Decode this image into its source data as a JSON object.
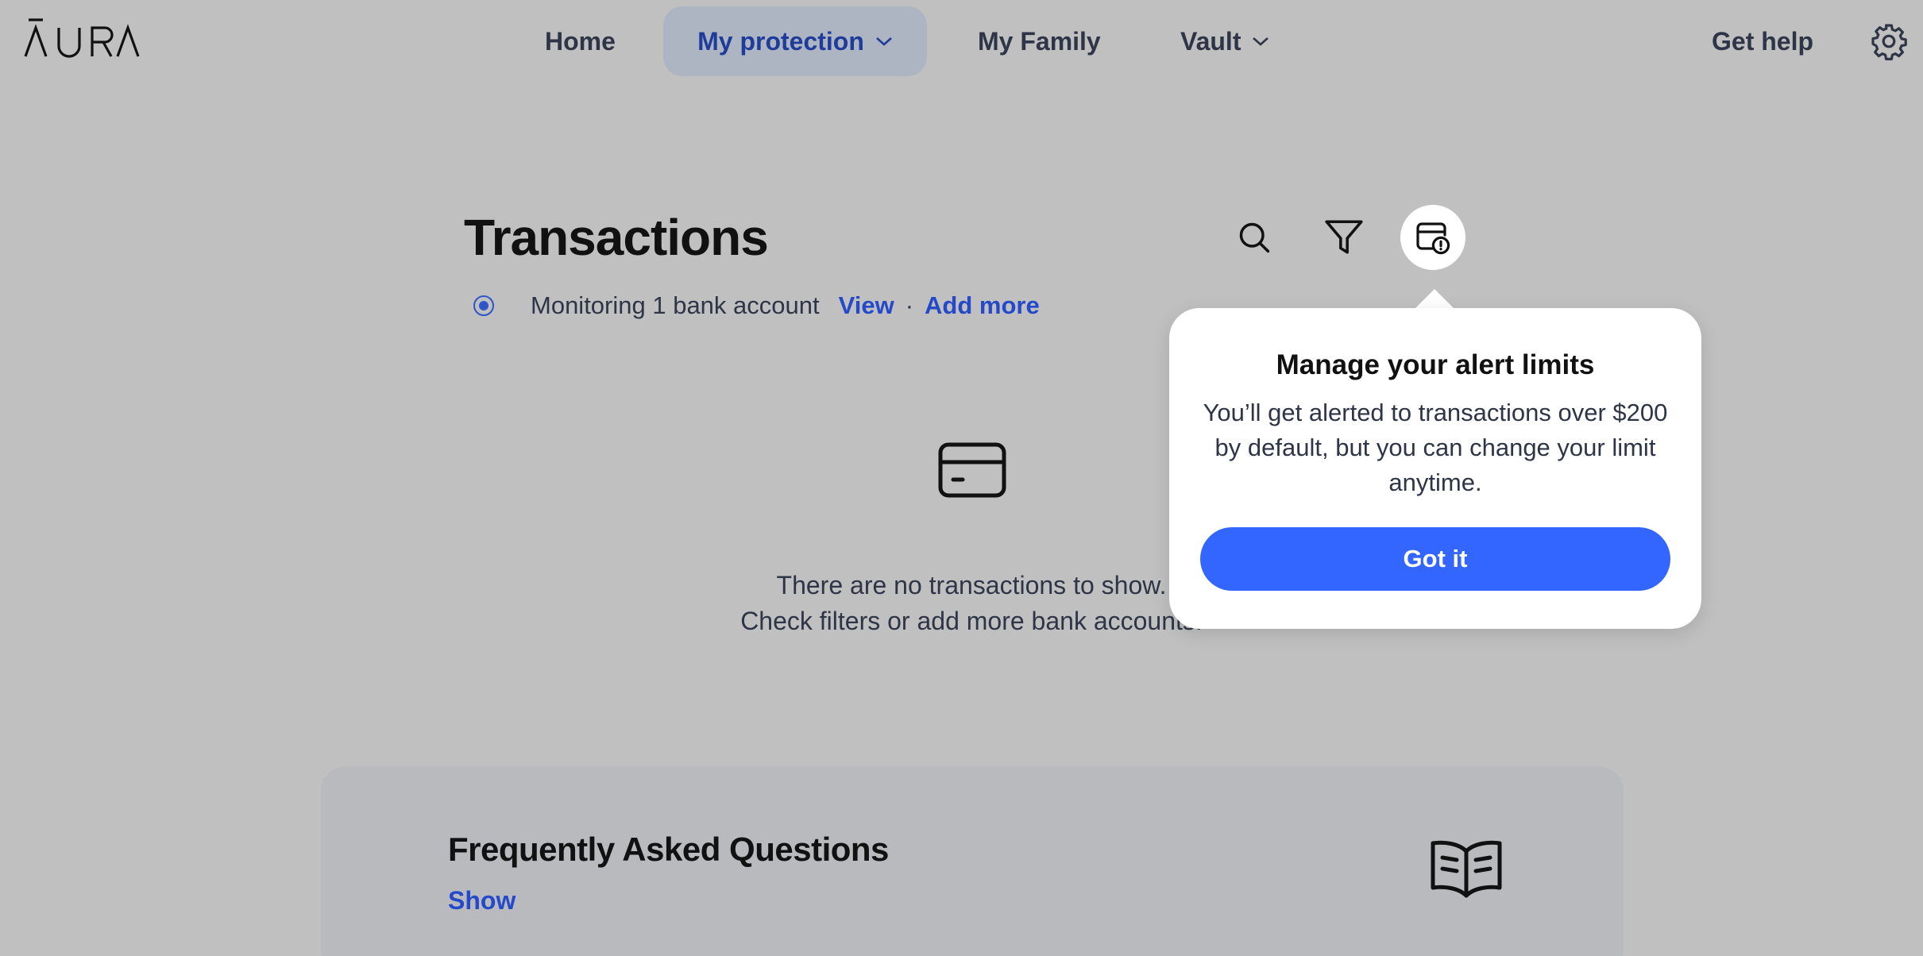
{
  "app": {
    "logo_text": "AURA"
  },
  "nav": {
    "home": "Home",
    "my_protection": "My protection",
    "my_family": "My Family",
    "vault": "Vault",
    "get_help": "Get help"
  },
  "page": {
    "title": "Transactions",
    "monitoring_text": "Monitoring 1 bank account",
    "view_link": "View",
    "separator": "·",
    "add_more_link": "Add more"
  },
  "empty_state": {
    "line1": "There are no transactions to show.",
    "line2": "Check filters or add more bank accounts."
  },
  "faq": {
    "title": "Frequently Asked Questions",
    "show_link": "Show"
  },
  "popover": {
    "title": "Manage your alert limits",
    "body": "You’ll get alerted to transactions over $200 by default, but you can change your limit anytime.",
    "button": "Got it"
  },
  "colors": {
    "accent": "#3366ff",
    "link": "#2449c9",
    "overlay_bg": "#c0c0c0"
  },
  "icons": [
    "aura-logo",
    "chevron-down-icon",
    "gear-icon",
    "search-icon",
    "filter-icon",
    "alert-limit-icon",
    "radio-selected-icon",
    "credit-card-icon",
    "book-icon"
  ]
}
